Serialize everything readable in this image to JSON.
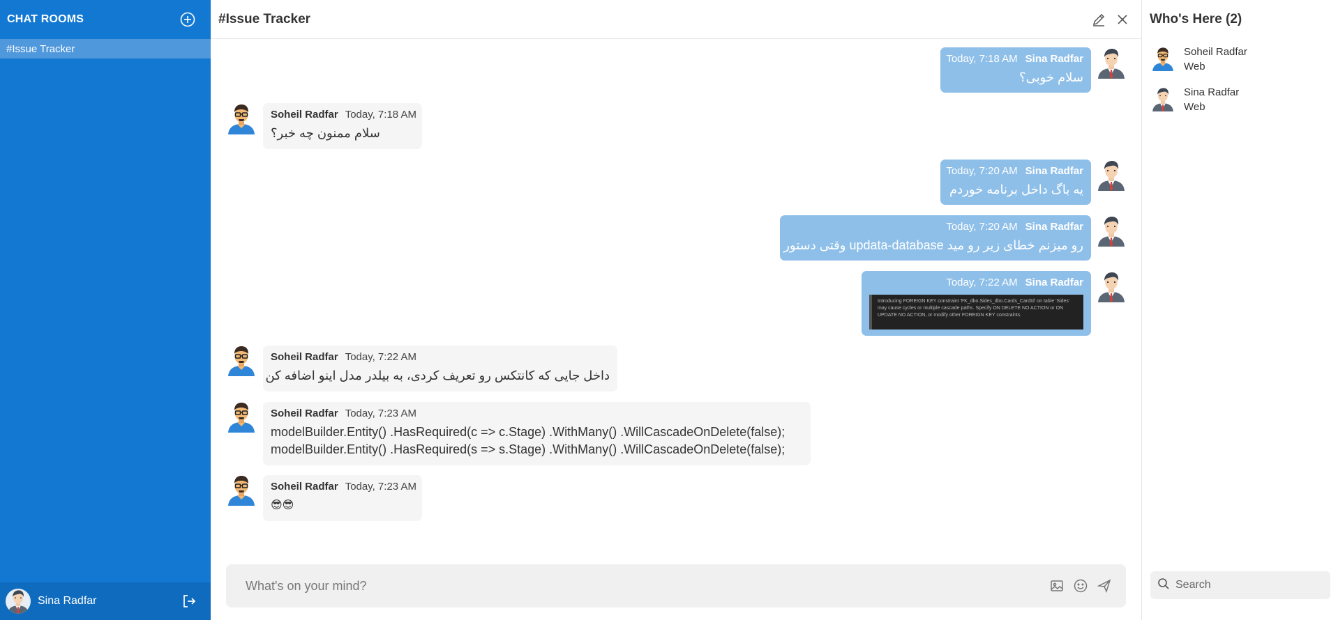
{
  "sidebar": {
    "title": "CHAT ROOMS",
    "rooms": [
      {
        "label": "#Issue Tracker",
        "active": true
      }
    ],
    "current_user": "Sina Radfar"
  },
  "room": {
    "title": "#Issue Tracker"
  },
  "messages": [
    {
      "author": "Sina Radfar",
      "time": "Today, 7:18 AM",
      "mine": true,
      "text": "سلام خوبی؟"
    },
    {
      "author": "Soheil Radfar",
      "time": "Today, 7:18 AM",
      "mine": false,
      "text": "سلام ممنون چه خبر؟"
    },
    {
      "author": "Sina Radfar",
      "time": "Today, 7:20 AM",
      "mine": true,
      "text": "یه باگ داخل برنامه خوردم"
    },
    {
      "author": "Sina Radfar",
      "time": "Today, 7:20 AM",
      "mine": true,
      "text": "رو میزنم خطای زیر رو مید updata-database وقتی دستور"
    },
    {
      "author": "Sina Radfar",
      "time": "Today, 7:22 AM",
      "mine": true,
      "image_text": "Introducing FOREIGN KEY constraint 'FK_dbo.Sides_dbo.Cards_CardId' on table 'Sides' may cause cycles or multiple cascade paths. Specify ON DELETE NO ACTION or ON UPDATE NO ACTION, or modify other FOREIGN KEY constraints."
    },
    {
      "author": "Soheil Radfar",
      "time": "Today, 7:22 AM",
      "mine": false,
      "text": "داخل جایی که کانتکس رو تعریف کردی، به بیلدر مدل اینو اضافه کن"
    },
    {
      "author": "Soheil Radfar",
      "time": "Today, 7:23 AM",
      "mine": false,
      "lines": [
        "modelBuilder.Entity() .HasRequired(c => c.Stage) .WithMany() .WillCascadeOnDelete(false);",
        "modelBuilder.Entity() .HasRequired(s => s.Stage) .WithMany() .WillCascadeOnDelete(false);"
      ]
    },
    {
      "author": "Soheil Radfar",
      "time": "Today, 7:23 AM",
      "mine": false,
      "text": "😎😎"
    }
  ],
  "composer": {
    "placeholder": "What's on your mind?"
  },
  "participants": {
    "title": "Who's Here (2)",
    "members": [
      {
        "name": "Soheil Radfar",
        "status": "Web"
      },
      {
        "name": "Sina Radfar",
        "status": "Web"
      }
    ]
  },
  "search": {
    "placeholder": "Search"
  },
  "icons": {
    "add_room": "plus-circle-icon",
    "logout": "logout-icon",
    "edit": "pencil-icon",
    "close": "close-icon",
    "image": "image-icon",
    "emoji": "smiley-icon",
    "send": "send-icon",
    "search": "search-icon"
  },
  "colors": {
    "sidebar": "#1278d2",
    "active_room": "#4f98dc",
    "my_bubble": "#8ebfe9",
    "their_bubble": "#f5f5f5"
  }
}
